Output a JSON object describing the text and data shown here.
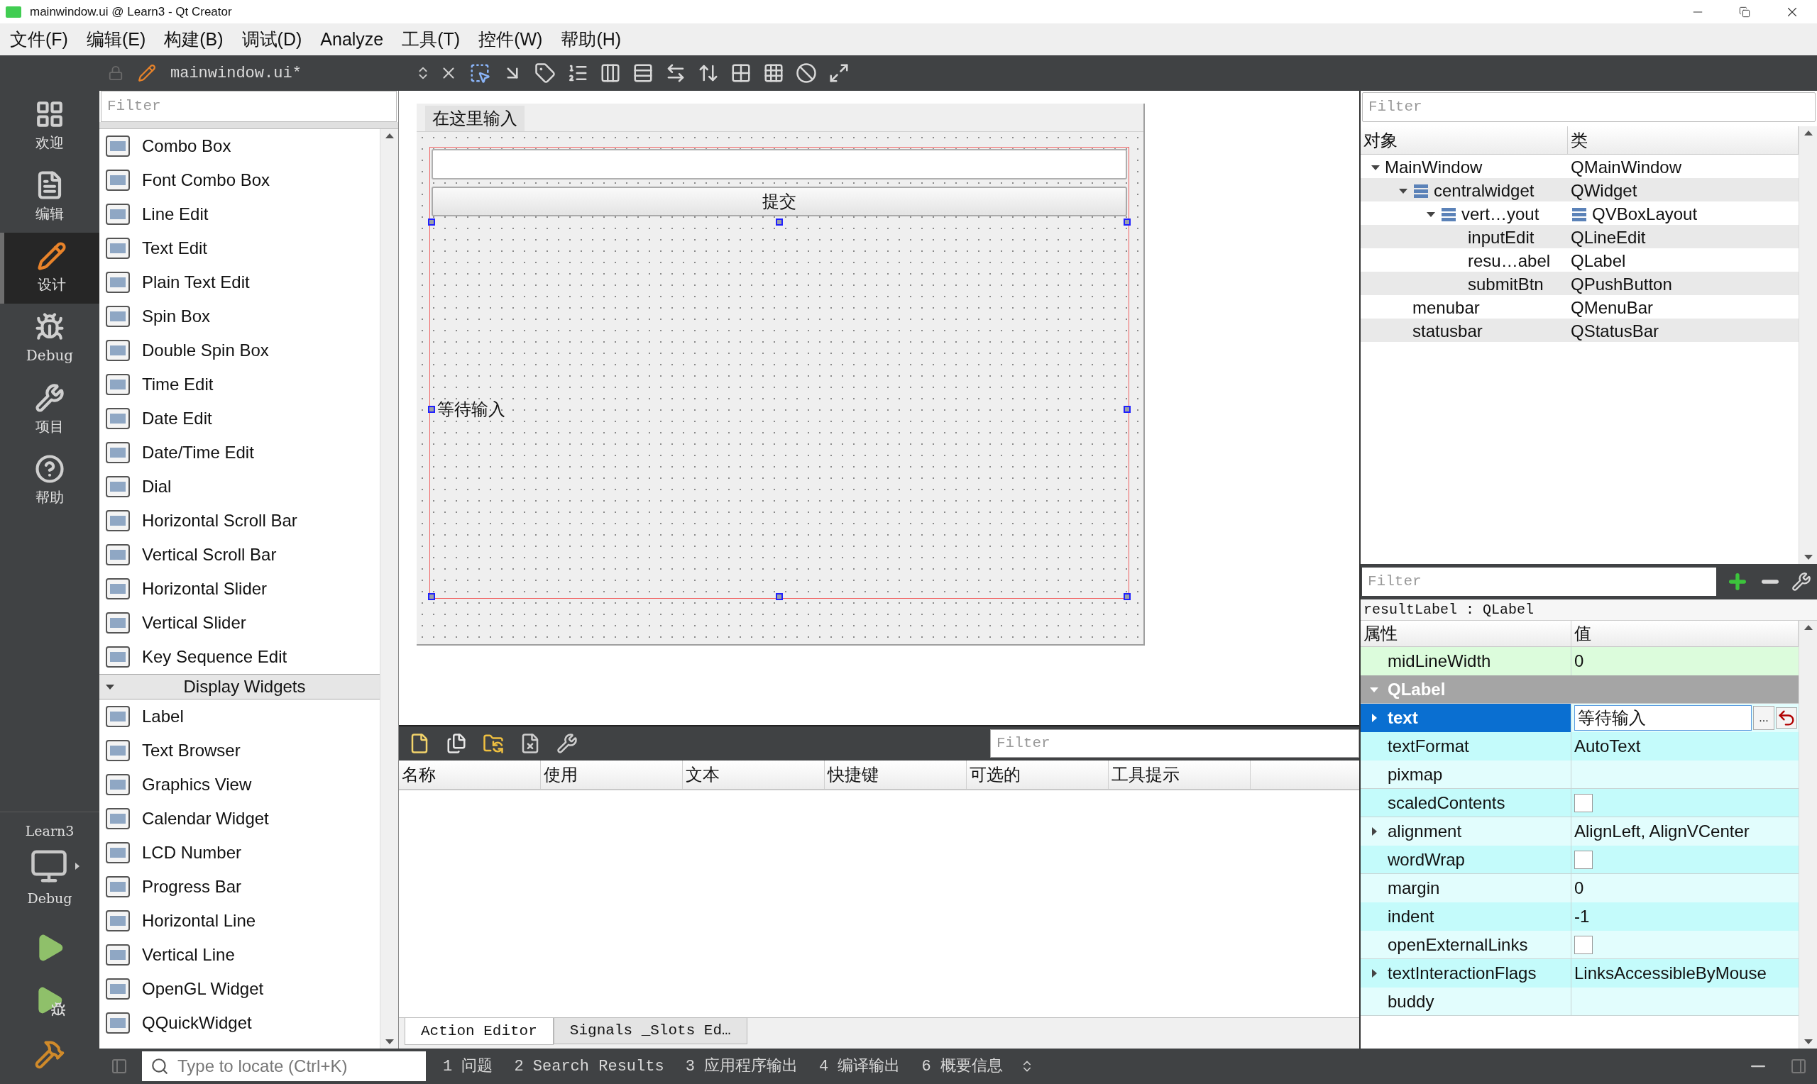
{
  "window": {
    "title": "mainwindow.ui @ Learn3 - Qt Creator"
  },
  "menu": [
    "文件(F)",
    "编辑(E)",
    "构建(B)",
    "调试(D)",
    "Analyze",
    "工具(T)",
    "控件(W)",
    "帮助(H)"
  ],
  "editor_toolbar": {
    "file_name": "mainwindow.ui*"
  },
  "mode_bar": {
    "modes": [
      {
        "label": "欢迎",
        "selected": false
      },
      {
        "label": "编辑",
        "selected": false
      },
      {
        "label": "设计",
        "selected": true
      },
      {
        "label": "Debug",
        "selected": false
      },
      {
        "label": "项目",
        "selected": false
      },
      {
        "label": "帮助",
        "selected": false
      }
    ],
    "kit": {
      "project": "Learn3",
      "build": "Debug"
    }
  },
  "widget_box": {
    "filter": {
      "placeholder": "Filter"
    },
    "items": [
      "Combo Box",
      "Font Combo Box",
      "Line Edit",
      "Text Edit",
      "Plain Text Edit",
      "Spin Box",
      "Double Spin Box",
      "Time Edit",
      "Date Edit",
      "Date/Time Edit",
      "Dial",
      "Horizontal Scroll Bar",
      "Vertical Scroll Bar",
      "Horizontal Slider",
      "Vertical Slider",
      "Key Sequence Edit"
    ],
    "sections": [
      {
        "title": "Display Widgets",
        "expanded": true,
        "items": [
          "Label",
          "Text Browser",
          "Graphics View",
          "Calendar Widget",
          "LCD Number",
          "Progress Bar",
          "Horizontal Line",
          "Vertical Line",
          "OpenGL Widget",
          "QQuickWidget"
        ]
      }
    ]
  },
  "form": {
    "menu_item": "在这里输入",
    "button": "提交",
    "label": "等待输入"
  },
  "action_editor": {
    "filter": {
      "placeholder": "Filter"
    },
    "columns": [
      "名称",
      "使用",
      "文本",
      "快捷键",
      "可选的",
      "工具提示"
    ],
    "tabs": [
      {
        "label": "Action Editor",
        "selected": true
      },
      {
        "label": "Signals _Slots Ed…",
        "selected": false
      }
    ]
  },
  "object_inspector": {
    "filter": {
      "placeholder": "Filter"
    },
    "columns": [
      "对象",
      "类"
    ],
    "tree": [
      {
        "name": "MainWindow",
        "class": "QMainWindow",
        "kind": "widget",
        "expanded": true,
        "children": [
          {
            "name": "centralwidget",
            "class": "QWidget",
            "kind": "container",
            "expanded": true,
            "children": [
              {
                "name": "vert…yout",
                "class": "QVBoxLayout",
                "kind": "layout",
                "expanded": true,
                "children": [
                  {
                    "name": "inputEdit",
                    "class": "QLineEdit",
                    "kind": "widget"
                  },
                  {
                    "name": "resu…abel",
                    "class": "QLabel",
                    "kind": "widget"
                  },
                  {
                    "name": "submitBtn",
                    "class": "QPushButton",
                    "kind": "widget"
                  }
                ]
              }
            ]
          },
          {
            "name": "menubar",
            "class": "QMenuBar",
            "kind": "widget"
          },
          {
            "name": "statusbar",
            "class": "QStatusBar",
            "kind": "widget"
          }
        ]
      }
    ]
  },
  "property_editor": {
    "filter": {
      "placeholder": "Filter"
    },
    "object": "resultLabel : QLabel",
    "columns": [
      "属性",
      "值"
    ],
    "rows": [
      {
        "kind": "value",
        "name": "midLineWidth",
        "value": "0",
        "color": "#dcfcdc",
        "expandable": false,
        "selected": false
      },
      {
        "kind": "category",
        "name": "QLabel",
        "expanded": true
      },
      {
        "kind": "value",
        "name": "text",
        "value": "等待输入",
        "button": "...",
        "color": "#e2fdfd",
        "expandable": true,
        "selected": true
      },
      {
        "kind": "value",
        "name": "textFormat",
        "value": "AutoText",
        "color": "#c4fbfb",
        "expandable": false,
        "selected": false
      },
      {
        "kind": "value",
        "name": "pixmap",
        "color": "#e2fdfd",
        "expandable": false,
        "selected": false
      },
      {
        "kind": "checkbox",
        "name": "scaledContents",
        "checked": false,
        "color": "#c4fbfb",
        "expandable": false,
        "selected": false
      },
      {
        "kind": "value",
        "name": "alignment",
        "value": "AlignLeft, AlignVCenter",
        "color": "#e2fdfd",
        "expandable": true,
        "selected": false
      },
      {
        "kind": "checkbox",
        "name": "wordWrap",
        "checked": false,
        "color": "#c4fbfb",
        "expandable": false,
        "selected": false
      },
      {
        "kind": "value",
        "name": "margin",
        "value": "0",
        "color": "#e2fdfd",
        "expandable": false,
        "selected": false
      },
      {
        "kind": "value",
        "name": "indent",
        "value": "-1",
        "color": "#c4fbfb",
        "expandable": false,
        "selected": false
      },
      {
        "kind": "checkbox",
        "name": "openExternalLinks",
        "checked": false,
        "color": "#e2fdfd",
        "expandable": false,
        "selected": false
      },
      {
        "kind": "value",
        "name": "textInteractionFlags",
        "value": "LinksAccessibleByMouse",
        "color": "#c4fbfb",
        "expandable": true,
        "selected": false
      },
      {
        "kind": "value",
        "name": "buddy",
        "color": "#e2fdfd",
        "expandable": false,
        "selected": false
      }
    ]
  },
  "status_bar": {
    "locate": {
      "placeholder": "Type to locate (Ctrl+K)"
    },
    "panes": [
      {
        "number": "1",
        "label": "问题"
      },
      {
        "number": "2",
        "label": "Search Results"
      },
      {
        "number": "3",
        "label": "应用程序输出"
      },
      {
        "number": "4",
        "label": "编译输出"
      },
      {
        "number": "6",
        "label": "概要信息"
      }
    ]
  }
}
